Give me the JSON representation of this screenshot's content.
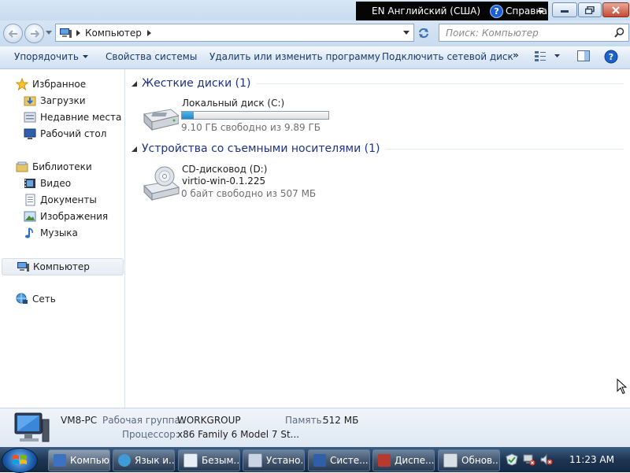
{
  "title_bar": {
    "language": "EN Английский (США)",
    "help_label": "Справка"
  },
  "address_bar": {
    "crumb": "Компьютер",
    "search_placeholder": "Поиск: Компьютер"
  },
  "command_bar": {
    "organize": "Упорядочить",
    "system_properties": "Свойства системы",
    "uninstall": "Удалить или изменить программу",
    "map_drive": "Подключить сетевой диск",
    "more": "»"
  },
  "nav_pane": {
    "favorites": "Избранное",
    "downloads": "Загрузки",
    "recent": "Недавние места",
    "desktop": "Рабочий стол",
    "libraries": "Библиотеки",
    "videos": "Видео",
    "documents": "Документы",
    "pictures": "Изображения",
    "music": "Музыка",
    "computer": "Компьютер",
    "network": "Сеть"
  },
  "content": {
    "hdd_group": "Жесткие диски (1)",
    "hdd_name": "Локальный диск (C:)",
    "hdd_free": "9.10 ГБ свободно из 9.89 ГБ",
    "hdd_used_fraction": 0.08,
    "removable_group": "Устройства со съемными носителями (1)",
    "cd_name": "CD-дисковод (D:)",
    "cd_label": "virtio-win-0.1.225",
    "cd_free": "0 байт свободно из 507 МБ"
  },
  "details": {
    "pc_name": "VM8-PC",
    "workgroup_label": "Рабочая группа:",
    "workgroup_value": "WORKGROUP",
    "memory_label": "Память:",
    "memory_value": "512 МБ",
    "cpu_label": "Процессор:",
    "cpu_value": "x86 Family 6 Model 7 St..."
  },
  "taskbar": {
    "items": [
      "Компью...",
      "Язык и...",
      "Безым...",
      "Устано...",
      "Систе...",
      "Диспе...",
      "Обнов..."
    ],
    "clock": "11:23 AM"
  }
}
